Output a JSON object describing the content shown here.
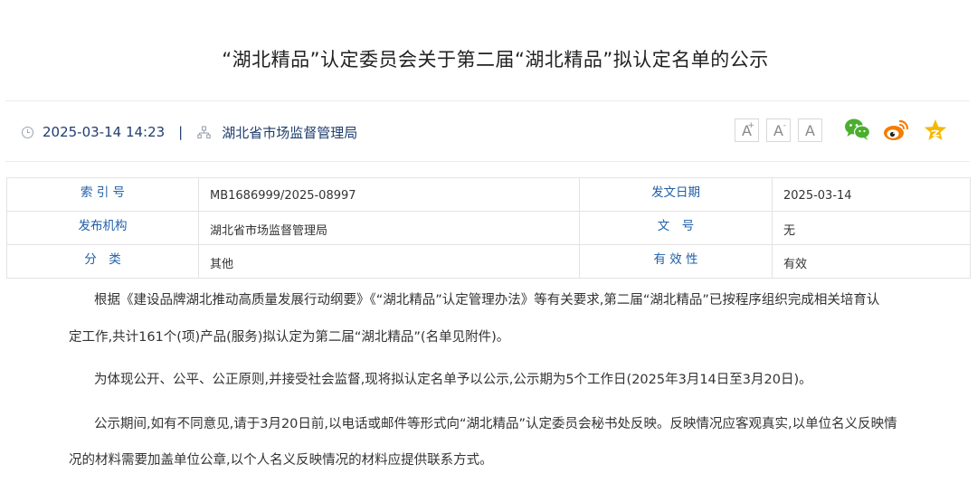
{
  "article": {
    "title": "“湖北精品”认定委员会关于第二届“湖北精品”拟认定名单的公示",
    "date": "2025-03-14 14:23",
    "separator": "|",
    "source": "湖北省市场监督管理局"
  },
  "toolbar": {
    "font_larger": "A",
    "font_larger_sup": "+",
    "font_smaller": "A",
    "font_smaller_sup": "-",
    "font_reset": "A"
  },
  "info": {
    "rows": [
      {
        "k1": "索 引 号",
        "v1": "MB1686999/2025-08997",
        "k2": "发文日期",
        "v2": "2025-03-14"
      },
      {
        "k1": "发布机构",
        "v1": "湖北省市场监督管理局",
        "k2": "文　号",
        "v2": "无"
      },
      {
        "k1": "分　类",
        "v1": "其他",
        "k2": "有 效 性",
        "v2": "有效"
      }
    ]
  },
  "body": {
    "p1_line1": "根据《建设品牌湖北推动高质量发展行动纲要》《“湖北精品”认定管理办法》等有关要求,第二届“湖北精品”已按程序组织完成相关培育认",
    "p1_line2": "定工作,共计161个(项)产品(服务)拟认定为第二届“湖北精品”(名单见附件)。",
    "p2_line1": "为体现公开、公平、公正原则,并接受社会监督,现将拟认定名单予以公示,公示期为5个工作日(2025年3月14日至3月20日)。",
    "p3_line1": "公示期间,如有不同意见,请于3月20日前,以电话或邮件等形式向“湖北精品”认定委员会秘书处反映。反映情况应客观真实,以单位名义反映情",
    "p3_line2": "况的材料需要加盖单位公章,以个人名义反映情况的材料应提供联系方式。"
  },
  "colors": {
    "label_blue": "#1f5fa8",
    "meta_blue": "#1f3d6e",
    "wechat_green": "#4cae2f",
    "weibo_orange": "#f57c00",
    "star_yellow": "#f5b800"
  },
  "icons": [
    "clock-icon",
    "org-icon",
    "wechat-icon",
    "weibo-icon",
    "star-icon"
  ]
}
